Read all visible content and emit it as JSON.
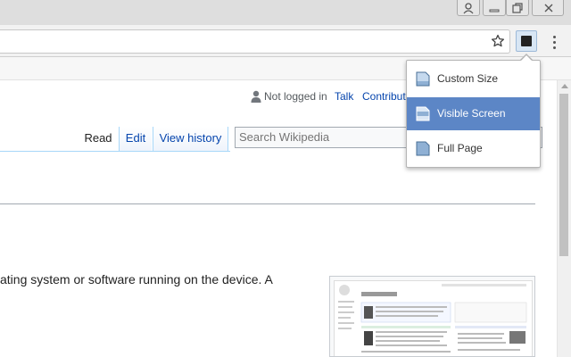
{
  "window": {
    "controls": [
      "user-icon",
      "minimize-icon",
      "restore-icon",
      "close-icon"
    ]
  },
  "toolbar": {
    "url": "",
    "extension_icon": "screenshot-extension-icon"
  },
  "wiki": {
    "user_status": "Not logged in",
    "talk": "Talk",
    "contributions": "Contribut",
    "tabs": [
      {
        "label": "Read"
      },
      {
        "label": "Edit"
      },
      {
        "label": "View history"
      }
    ],
    "search_placeholder": "Search Wikipedia",
    "body_text": "ating system or software running on the device. A"
  },
  "popup": {
    "items": [
      {
        "label": "Custom Size",
        "selected": false
      },
      {
        "label": "Visible Screen",
        "selected": true
      },
      {
        "label": "Full Page",
        "selected": false
      }
    ]
  },
  "colors": {
    "accent": "#5c86c6",
    "link": "#0645ad"
  }
}
